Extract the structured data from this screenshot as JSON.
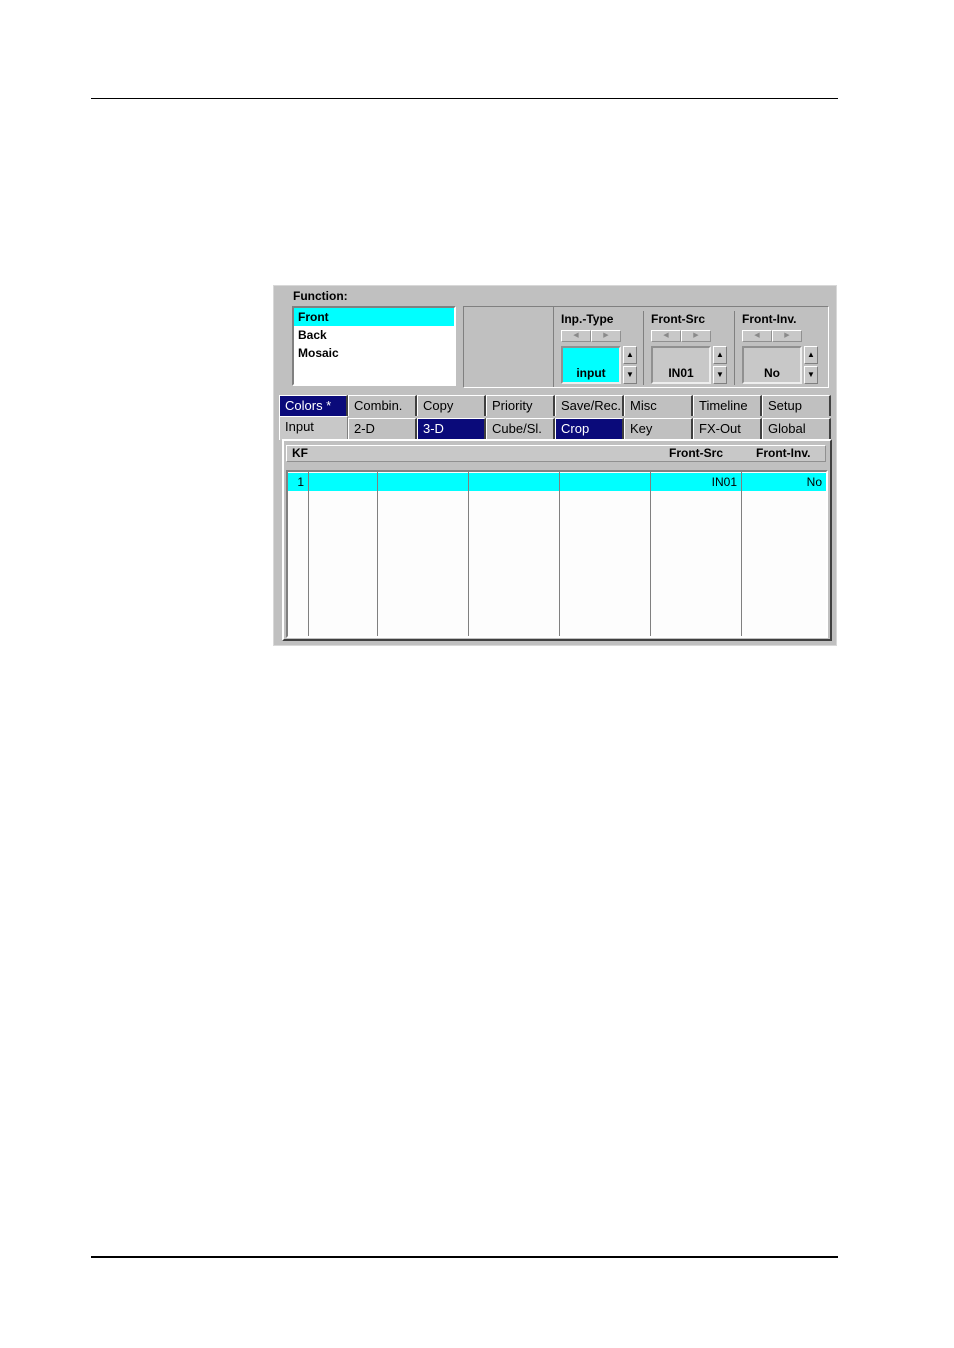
{
  "function": {
    "label": "Function:",
    "items": [
      {
        "label": "Front",
        "selected": true
      },
      {
        "label": "Back",
        "selected": false
      },
      {
        "label": "Mosaic",
        "selected": false
      }
    ]
  },
  "params": [
    {
      "title": "Inp.-Type",
      "value": "input",
      "active": true
    },
    {
      "title": "Front-Src",
      "value": "IN01",
      "active": false
    },
    {
      "title": "Front-Inv.",
      "value": "No",
      "active": false
    }
  ],
  "icons": {
    "left_arrow": "◀",
    "right_arrow": "▶",
    "up_arrow": "▲",
    "down_arrow": "▼"
  },
  "tabs": {
    "row1": [
      "Colors *",
      "Combin.",
      "Copy",
      "Priority",
      "Save/Rec.",
      "Misc",
      "Timeline",
      "Setup"
    ],
    "row2": [
      "Input",
      "2-D",
      "3-D",
      "Cube/Sl.",
      "Crop",
      "Key",
      "FX-Out",
      "Global"
    ],
    "highlighted": [
      "Colors *",
      "3-D",
      "Crop"
    ],
    "active": "Input"
  },
  "table": {
    "headers": {
      "kf": "KF",
      "front_src": "Front-Src",
      "front_inv": "Front-Inv."
    },
    "rows": [
      {
        "kf": "1",
        "c2": "",
        "c3": "",
        "c4": "",
        "c5": "",
        "front_src": "IN01",
        "front_inv": "No"
      }
    ]
  },
  "colors": {
    "selection": "#00ffff",
    "tab_highlight": "#0a0a7a",
    "panel": "#c0c0c0"
  }
}
